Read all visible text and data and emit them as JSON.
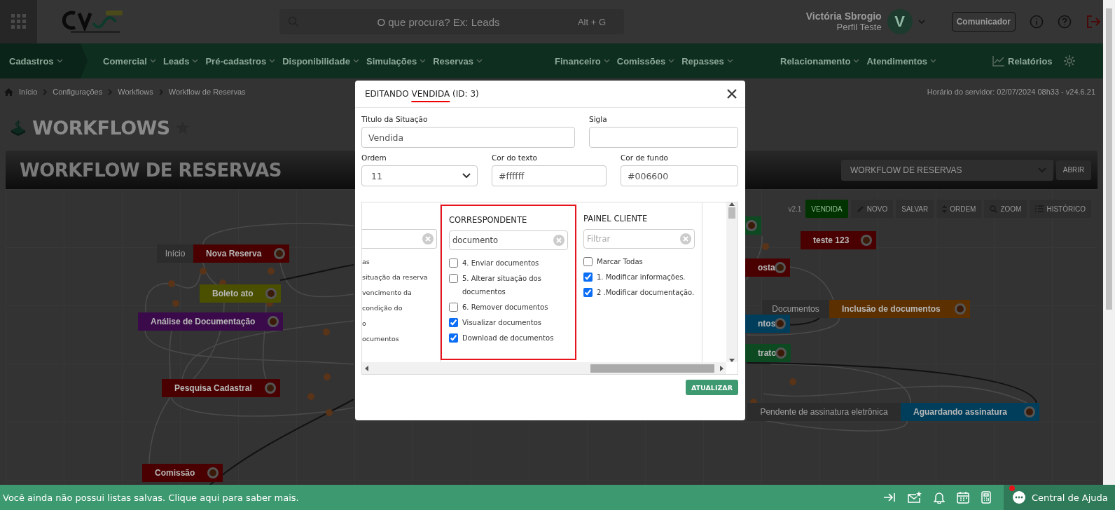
{
  "header": {
    "search_placeholder": "O que procura? Ex: Leads",
    "shortcut": "Alt + G",
    "user_name": "Victória Sbrogio",
    "user_profile": "Perfil Teste",
    "avatar_initial": "V",
    "communicator_button": "Comunicador"
  },
  "nav_groups": [
    [
      {
        "label": "Cadastros",
        "kind": "menu"
      }
    ],
    [
      {
        "label": "Comercial",
        "kind": "menu"
      },
      {
        "label": "Leads",
        "kind": "menu"
      },
      {
        "label": "Pré-cadastros",
        "kind": "menu"
      },
      {
        "label": "Disponibilidade",
        "kind": "menu"
      },
      {
        "label": "Simulações",
        "kind": "menu"
      },
      {
        "label": "Reservas",
        "kind": "menu"
      }
    ],
    [
      {
        "label": "Financeiro",
        "kind": "menu"
      },
      {
        "label": "Comissões",
        "kind": "menu"
      },
      {
        "label": "Repasses",
        "kind": "menu"
      }
    ],
    [
      {
        "label": "Relacionamento",
        "kind": "menu"
      },
      {
        "label": "Atendimentos",
        "kind": "menu"
      }
    ],
    [
      {
        "label": "Relatórios",
        "kind": "link"
      }
    ]
  ],
  "breadcrumb": [
    "Início",
    "Configurações",
    "Workflows",
    "Workflow de Reservas"
  ],
  "server_time": "Horário do servidor: 02/07/2024 08h33 - v24.6.21",
  "page_title": "WORKFLOWS",
  "banner": {
    "title": "WORKFLOW DE RESERVAS",
    "select_value": "WORKFLOW DE RESERVAS",
    "open_button": "ABRIR"
  },
  "toolbar": {
    "version": "v2.1",
    "status": {
      "label": "VENDIDA",
      "color": "#003300"
    },
    "buttons": [
      {
        "label": "NOVO",
        "kind": "edit"
      },
      {
        "label": "SALVAR",
        "kind": "plain"
      },
      {
        "label": "ORDEM",
        "kind": "sort"
      },
      {
        "label": "ZOOM",
        "kind": "zoom"
      },
      {
        "label": "HISTÓRICO",
        "kind": "list"
      }
    ]
  },
  "nodes": [
    {
      "label": "Nova Reserva",
      "tag": "Início",
      "color": "#4a0000"
    },
    {
      "label": "Boleto ato",
      "color": "#4b5000"
    },
    {
      "label": "Análise de Documentação",
      "color": "#3a0a4a"
    },
    {
      "label": "Pesquisa Cadastral",
      "color": "#4a0000"
    },
    {
      "label": "Comissão",
      "color": "#4a0000"
    },
    {
      "color": "#0d4a22"
    },
    {
      "label": "teste 123",
      "color": "#4a0000"
    },
    {
      "label": "osta",
      "color": "#4a0000"
    },
    {
      "label": "Inclusão de documentos",
      "tag": "Documentos",
      "color": "#5c3000"
    },
    {
      "label": "ntos",
      "color": "#003e5c"
    },
    {
      "label": "trato",
      "color": "#0d4a22"
    },
    {
      "label": "Aguardando assinatura",
      "tag": "Pendente de assinatura eletrônica",
      "color": "#003e5c"
    }
  ],
  "modal": {
    "title_prefix": "EDITANDO",
    "title_name": "VENDIDA",
    "title_suffix": "(ID: 3)",
    "fields": [
      {
        "label": "Titulo da Situação",
        "value": "Vendida",
        "kind": "text"
      },
      {
        "label": "Sigla",
        "kind": "text"
      },
      {
        "label": "Ordem",
        "value": "11",
        "kind": "select"
      },
      {
        "label": "Cor do texto",
        "value": "#ffffff",
        "kind": "text"
      },
      {
        "label": "Cor de fundo",
        "value": "#006600",
        "kind": "text"
      }
    ],
    "columns": [
      {
        "highlighted": false,
        "items": [
          {
            "label": "as"
          },
          {
            "label": "situação da reserva"
          },
          {
            "label": "vencimento da"
          },
          {
            "label": "condição do"
          },
          {
            "label": "o"
          },
          {
            "label": "ocumentos"
          }
        ]
      },
      {
        "title": "CORRESPONDENTE",
        "filter_value": "documento",
        "highlighted": true,
        "items": [
          {
            "label": "4. Enviar documentos",
            "checked": false
          },
          {
            "label": "5. Alterar situação dos documentos",
            "checked": false
          },
          {
            "label": "6. Remover documentos",
            "checked": false
          },
          {
            "label": "Visualizar documentos",
            "checked": true
          },
          {
            "label": "Download de documentos",
            "checked": true
          }
        ]
      },
      {
        "title": "PAINEL CLIENTE",
        "filter_placeholder": "Filtrar",
        "highlighted": false,
        "items": [
          {
            "label": "Marcar Todas",
            "checked": false
          },
          {
            "label": "1. Modificar informações.",
            "checked": true
          },
          {
            "label": "2 .Modificar documentação.",
            "checked": true
          }
        ]
      }
    ],
    "update_button": "ATUALIZAR"
  },
  "footer": {
    "message": "Você ainda não possui listas salvas. Clique aqui para saber mais.",
    "help": "Central de Ajuda",
    "help_notification": true
  }
}
